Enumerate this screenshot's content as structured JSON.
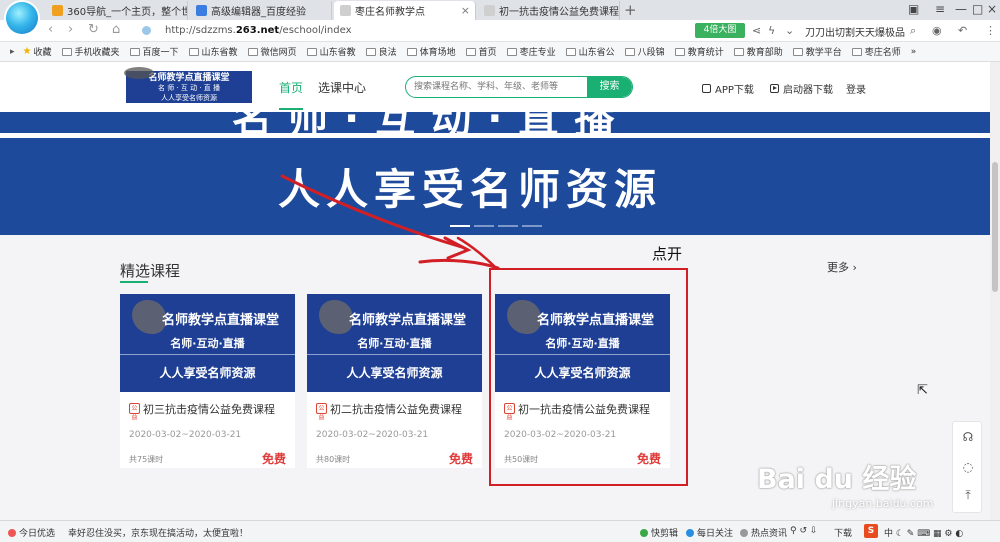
{
  "browser": {
    "tabs": [
      {
        "label": "360导航_一个主页，整个世界",
        "color": "#f0a020"
      },
      {
        "label": "高级编辑器_百度经验",
        "color": "#3b7de0"
      },
      {
        "label": "枣庄名师教学点",
        "color": "#cfcfcf",
        "active": true
      },
      {
        "label": "初一抗击疫情公益免费课程",
        "color": "#cfcfcf"
      }
    ],
    "new_tab": "+",
    "url_prefix": "http://sdzzms.",
    "url_domain": "263.net",
    "url_suffix": "/eschool/index",
    "speed_badge": "4倍大图",
    "promo": "刀刀出切割天天爆极品",
    "bookmarks": [
      "收藏",
      "手机收藏夹",
      "百度一下",
      "山东省教",
      "微信网页",
      "山东省教",
      "良法",
      "体育场地",
      "首页",
      "枣庄专业",
      "山东省公",
      "八段锦",
      "教育统计",
      "教育部助",
      "教学平台",
      "枣庄名师"
    ],
    "bookmarks_more": "»"
  },
  "header": {
    "logo": {
      "line1": "名师教学点直播课堂",
      "line2": "名 师 · 互 动 · 直 播",
      "line3": "人人享受名师资源"
    },
    "nav_home": "首页",
    "nav_course": "选课中心",
    "search_placeholder": "搜索课程名称、学科、年级、老师等",
    "search_button": "搜索",
    "app_download": "APP下载",
    "launcher_download": "启动器下载",
    "login": "登录"
  },
  "banner": {
    "top_text": "名师·互动·直播",
    "slogan": "人人享受名师资源",
    "slide_count": 4,
    "active_slide": 0
  },
  "annotation": "点开",
  "section": {
    "title": "精选课程",
    "more": "更多 ›"
  },
  "cover": {
    "line1": "名师教学点直播课堂",
    "line2": "名师·互动·直播",
    "line3": "人人享受名师资源"
  },
  "courses": [
    {
      "badge": "公益",
      "title": "初三抗击疫情公益免费课程",
      "date": "2020-03-02~2020-03-21",
      "hours": "共75课时",
      "price": "免费"
    },
    {
      "badge": "公益",
      "title": "初二抗击疫情公益免费课程",
      "date": "2020-03-02~2020-03-21",
      "hours": "共80课时",
      "price": "免费"
    },
    {
      "badge": "公益",
      "title": "初一抗击疫情公益免费课程",
      "date": "2020-03-02~2020-03-21",
      "hours": "共50课时",
      "price": "免费"
    }
  ],
  "watermark": {
    "brand": "Bai du 经验",
    "url": "jingyan.baidu.com"
  },
  "statusbar": {
    "today": "今日优选",
    "news": "幸好忍住没买，京东现在搞活动，太便宜啦！",
    "quick_clip": "快剪辑",
    "daily_focus": "每日关注",
    "hot_news": "热点资讯",
    "download": "下载",
    "sogou": "S"
  },
  "colors": {
    "brand_green": "#1aaf73",
    "banner_blue": "#1e4a9c",
    "price_red": "#e03b3b",
    "annotation_red": "#d21f26"
  }
}
